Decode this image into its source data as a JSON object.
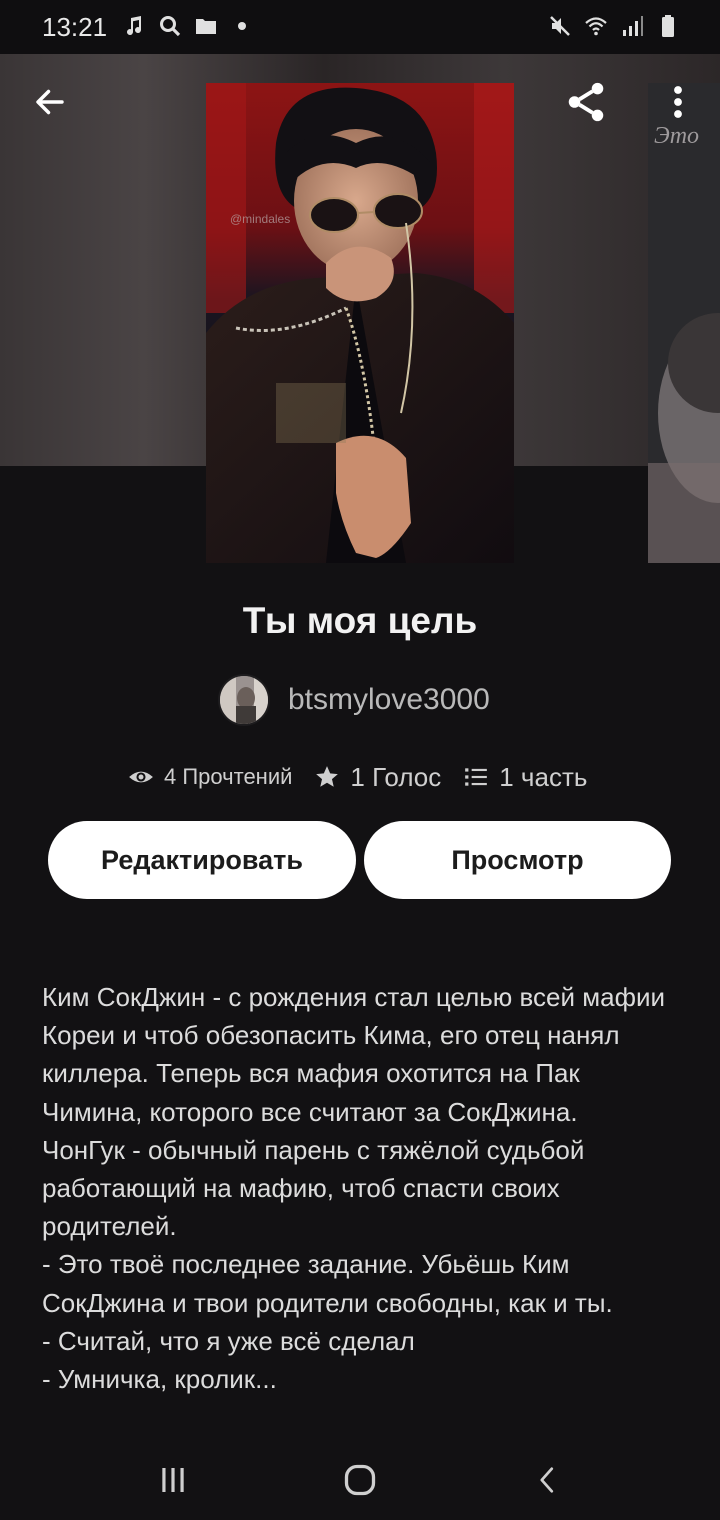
{
  "status_bar": {
    "time": "13:21",
    "left_icons": [
      "music-note-icon",
      "search-icon",
      "folder-icon",
      "dot-icon"
    ],
    "right_icons": [
      "mute-icon",
      "wifi-icon",
      "signal-icon",
      "battery-icon"
    ]
  },
  "toolbar": {
    "back_icon": "arrow-left-icon",
    "share_icon": "share-icon",
    "more_icon": "more-vertical-icon"
  },
  "story": {
    "cover_watermark": "@mindales",
    "next_cover_text": "Это",
    "title": "Ты моя цель",
    "author": "btsmylove3000",
    "stats": {
      "reads": "4 Прочтений",
      "votes": "1 Голос",
      "parts": "1 часть"
    },
    "buttons": {
      "edit": "Редактировать",
      "view": "Просмотр"
    },
    "description": "Ким СокДжин - с рождения стал целью всей мафии Кореи и чтоб обезопасить Кима, его отец нанял киллера. Теперь вся мафия охотится на Пак Чимина, которого все считают за СокДжина.\n   ЧонГук - обычный парень с тяжёлой судьбой работающий на мафию, чтоб спасти своих родителей.\n- Это твоё последнее задание. Убьёшь Ким СокДжина и твои родители свободны, как и ты.\n- Считай, что я уже всё сделал\n- Умничка, кролик..."
  },
  "navbar": {
    "recent_icon": "recent-apps-icon",
    "home_icon": "home-icon",
    "back_icon": "back-chevron-icon"
  },
  "colors": {
    "background": "#121113",
    "button_bg": "#ffffff",
    "text_primary": "#f2f2f2",
    "text_secondary": "#b9b9b9"
  }
}
